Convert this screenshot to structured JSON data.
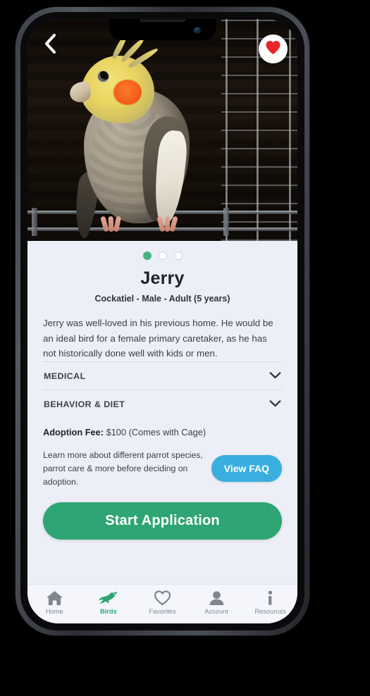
{
  "app": {
    "accent_green": "#2ea573",
    "accent_blue": "#3aaee0",
    "card_background": "#eceff7",
    "favorite_heart_color": "#e8262a"
  },
  "header": {
    "back_icon": "chevron-left-icon",
    "favorite_icon": "heart-filled-icon"
  },
  "gallery": {
    "image_alt": "Cockatiel perched on a cage bar",
    "dot_count": 3,
    "active_dot_index": 0
  },
  "pet": {
    "name": "Jerry",
    "meta": "Cockatiel - Male - Adult (5 years)",
    "description": "Jerry was well-loved in his previous home. He would be an ideal bird for a female primary caretaker, as he has not historically done well with kids or men."
  },
  "accordions": [
    {
      "label": "MEDICAL",
      "icon": "chevron-down-icon",
      "expanded": false
    },
    {
      "label": "BEHAVIOR & DIET",
      "icon": "chevron-down-icon",
      "expanded": false
    }
  ],
  "fee": {
    "label": "Adoption Fee:",
    "value": " $100 (Comes with Cage)"
  },
  "faq": {
    "text": "Learn more about different parrot species, parrot care & more before deciding on adoption.",
    "button_label": "View FAQ"
  },
  "cta": {
    "label": "Start Application"
  },
  "bottom_nav": {
    "items": [
      {
        "label": "Home",
        "icon": "home-icon",
        "active": false
      },
      {
        "label": "Birds",
        "icon": "bird-icon",
        "active": true
      },
      {
        "label": "Favorites",
        "icon": "heart-outline-icon",
        "active": false
      },
      {
        "label": "Account",
        "icon": "person-icon",
        "active": false
      },
      {
        "label": "Resources",
        "icon": "info-icon",
        "active": false
      }
    ]
  }
}
